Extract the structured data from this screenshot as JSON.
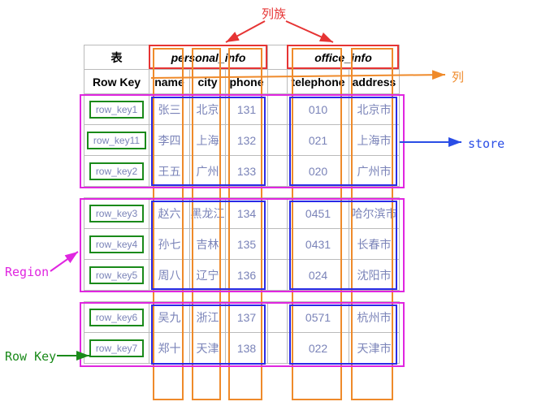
{
  "labels": {
    "cf": "列族",
    "col": "列",
    "store": "store",
    "region": "Region",
    "rowkey": "Row Key"
  },
  "header": {
    "table": "表",
    "personal": "personal_info",
    "office": "office_info",
    "rowkey": "Row Key",
    "name": "name",
    "city": "city",
    "phone": "phone",
    "tel": "telephone",
    "addr": "address"
  },
  "rows": [
    {
      "key": "row_key1",
      "name": "张三",
      "city": "北京",
      "phone": "131",
      "tel": "010",
      "addr": "北京市"
    },
    {
      "key": "row_key11",
      "name": "李四",
      "city": "上海",
      "phone": "132",
      "tel": "021",
      "addr": "上海市"
    },
    {
      "key": "row_key2",
      "name": "王五",
      "city": "广州",
      "phone": "133",
      "tel": "020",
      "addr": "广州市"
    },
    {
      "key": "row_key3",
      "name": "赵六",
      "city": "黑龙江",
      "phone": "134",
      "tel": "0451",
      "addr": "哈尔滨市"
    },
    {
      "key": "row_key4",
      "name": "孙七",
      "city": "吉林",
      "phone": "135",
      "tel": "0431",
      "addr": "长春市"
    },
    {
      "key": "row_key5",
      "name": "周八",
      "city": "辽宁",
      "phone": "136",
      "tel": "024",
      "addr": "沈阳市"
    },
    {
      "key": "row_key6",
      "name": "吴九",
      "city": "浙江",
      "phone": "137",
      "tel": "0571",
      "addr": "杭州市"
    },
    {
      "key": "row_key7",
      "name": "郑十",
      "city": "天津",
      "phone": "138",
      "tel": "022",
      "addr": "天津市"
    }
  ]
}
